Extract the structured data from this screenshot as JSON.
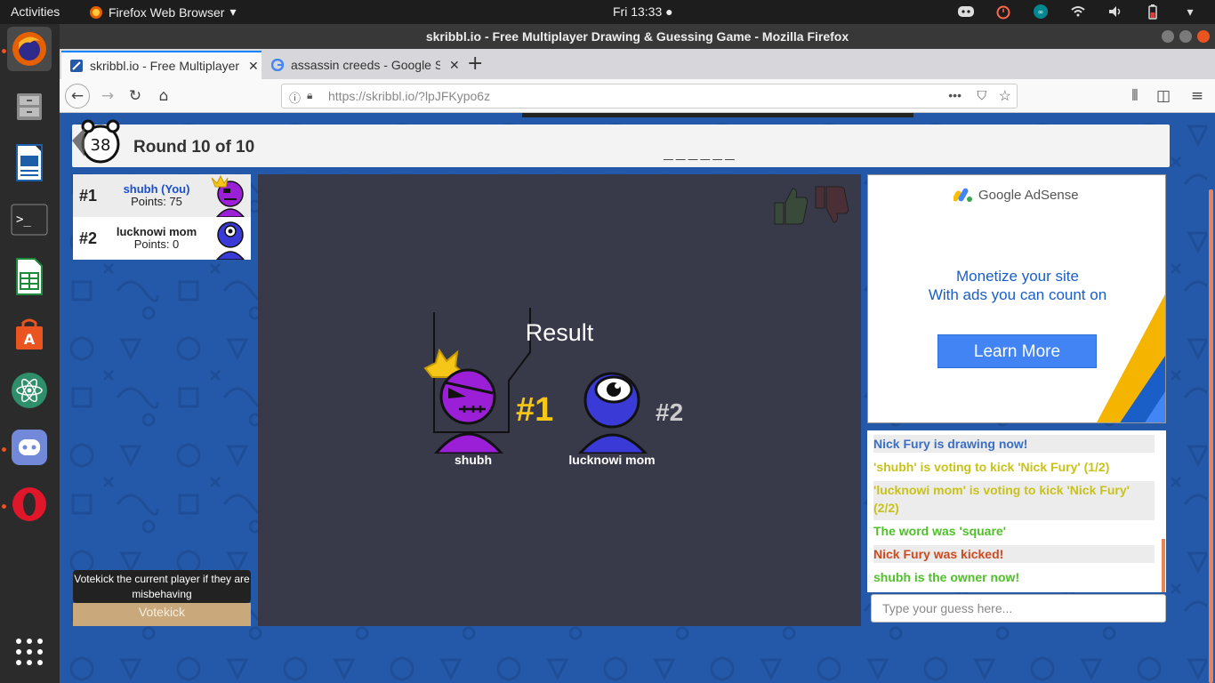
{
  "topbar": {
    "activities": "Activities",
    "app_name": "Firefox Web Browser",
    "clock": "Fri 13:33 ●"
  },
  "window": {
    "title": "skribbl.io - Free Multiplayer Drawing & Guessing Game - Mozilla Firefox"
  },
  "tabs": [
    {
      "label": "skribbl.io - Free Multiplayer",
      "active": true
    },
    {
      "label": "assassin creeds - Google Search",
      "active": false
    }
  ],
  "url": {
    "base": "https://skribbl.io/",
    "path": "?lpJFKypo6z"
  },
  "game": {
    "round_title": "Round 10 of 10",
    "word_hint": "______",
    "players": [
      {
        "rank": "#1",
        "name": "shubh (You)",
        "points": "Points: 75",
        "color": "#9b1fd6",
        "name_color": "#1a4fcf"
      },
      {
        "rank": "#2",
        "name": "lucknowi mom",
        "points": "Points: 0",
        "color": "#3a3ad6",
        "name_color": "#222222"
      }
    ],
    "votekick_tooltip": "Votekick the current player if they are misbehaving",
    "votekick_label": "Votekick",
    "result": {
      "title": "Result",
      "first_rank": "#1",
      "first_name": "shubh",
      "second_rank": "#2",
      "second_name": "lucknowi mom"
    }
  },
  "ad": {
    "brand": "Google AdSense",
    "line1": "Monetize your site",
    "line2": "With ads you can count on",
    "cta": "Learn More"
  },
  "chat": {
    "messages": [
      {
        "text": "Nick Fury is drawing now!",
        "color": "#3a6fc4"
      },
      {
        "text": "'shubh' is voting to kick 'Nick Fury' (1/2)",
        "color": "#c8c21a"
      },
      {
        "text": "'lucknowi mom' is voting to kick 'Nick Fury' (2/2)",
        "color": "#c8c21a"
      },
      {
        "text": "The word was 'square'",
        "color": "#4fbf2a"
      },
      {
        "text": "Nick Fury was kicked!",
        "color": "#cc4a1f"
      },
      {
        "text": "shubh is the owner now!",
        "color": "#4fbf2a"
      }
    ],
    "input_placeholder": "Type your guess here..."
  },
  "colors": {
    "accent_gold": "#f5c518",
    "background_blue": "#2458a8",
    "ubuntu_orange": "#e95420"
  }
}
